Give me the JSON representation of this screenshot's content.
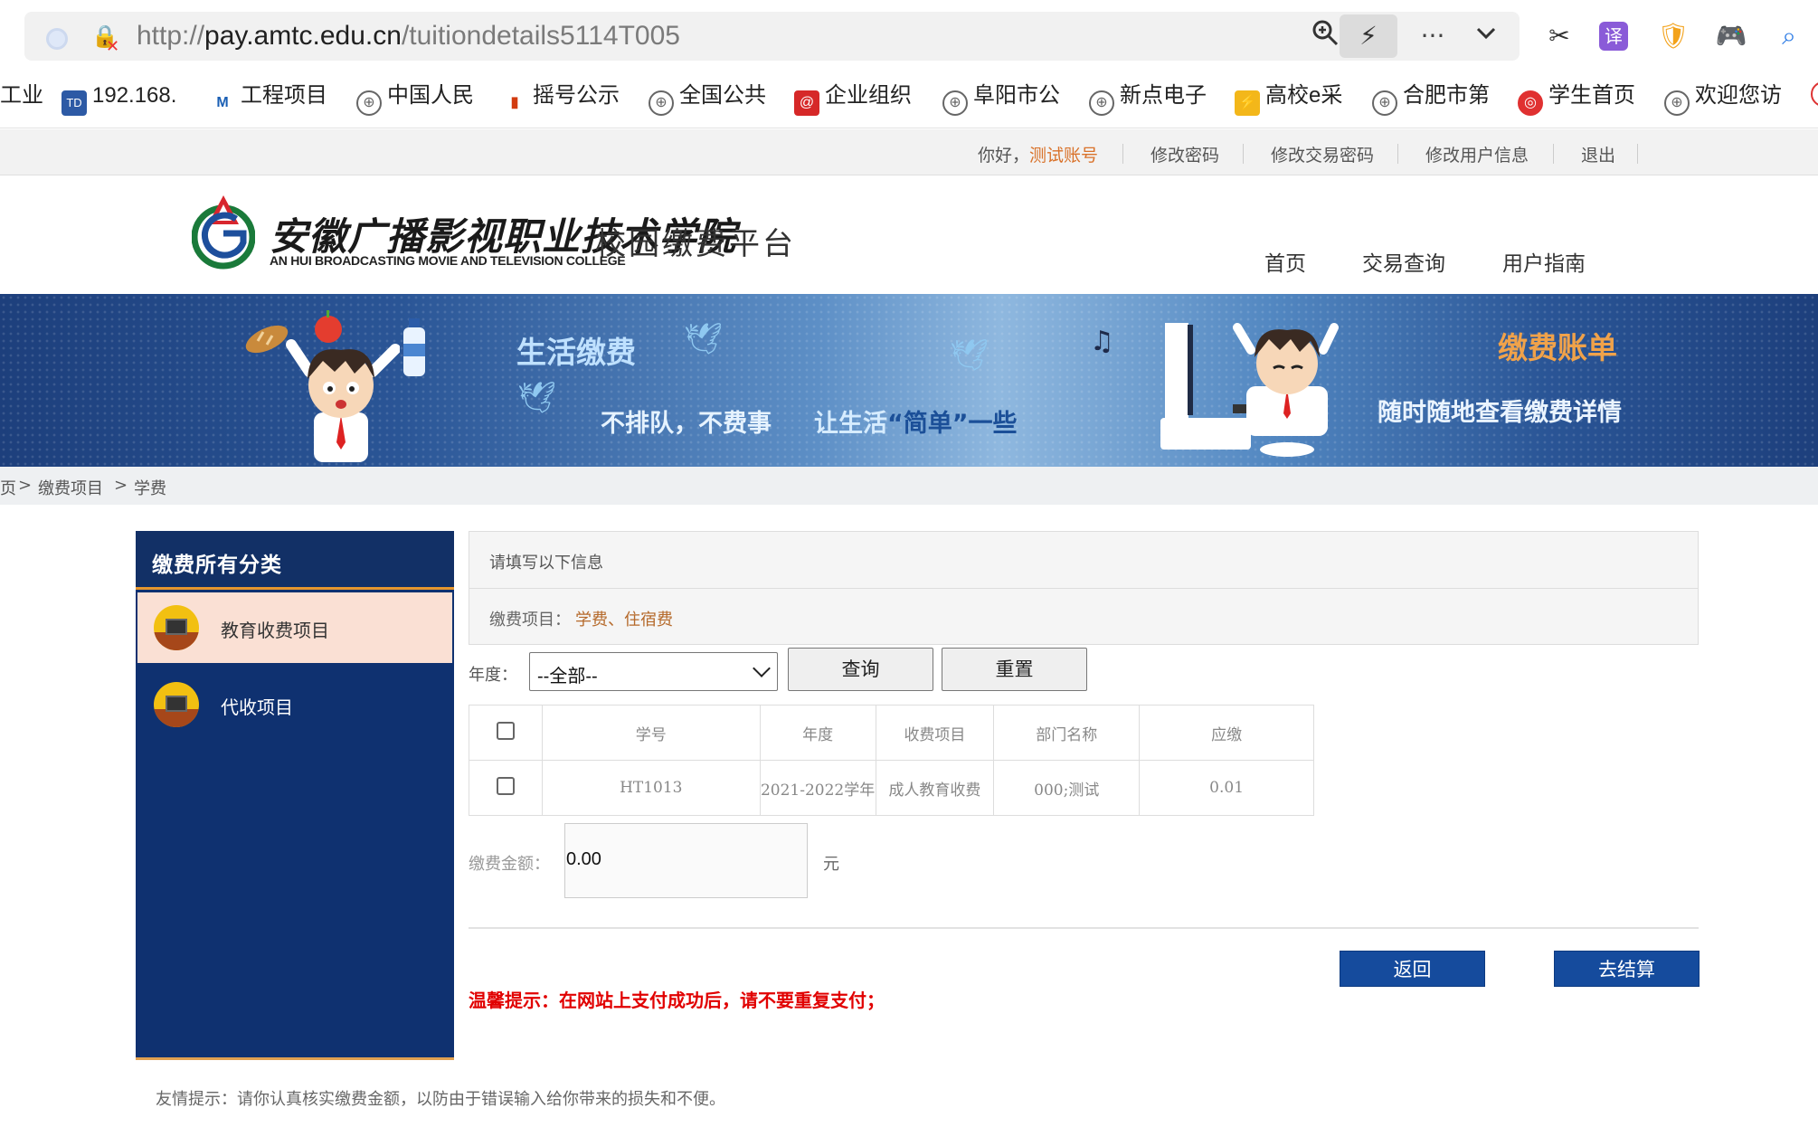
{
  "browser": {
    "url_prefix": "http://",
    "url_domain": "pay.amtc.edu.cn",
    "url_path": "/tuitiondetails5114T005",
    "bookmarks": [
      {
        "label": "工业",
        "icon": "globe-icon"
      },
      {
        "label": "192.168.",
        "icon": "td-icon"
      },
      {
        "label": "工程项目",
        "icon": "m-icon"
      },
      {
        "label": "中国人民",
        "icon": "globe-icon"
      },
      {
        "label": "摇号公示",
        "icon": "chart-icon"
      },
      {
        "label": "全国公共",
        "icon": "globe-icon"
      },
      {
        "label": "企业组织",
        "icon": "at-icon"
      },
      {
        "label": "阜阳市公",
        "icon": "globe-icon"
      },
      {
        "label": "新点电子",
        "icon": "globe-icon"
      },
      {
        "label": "高校e采",
        "icon": "lightning-icon"
      },
      {
        "label": "合肥市第",
        "icon": "globe-icon"
      },
      {
        "label": "学生首页",
        "icon": "weibo-icon"
      },
      {
        "label": "欢迎您访",
        "icon": "globe-icon"
      }
    ]
  },
  "topbar": {
    "greeting": "你好，",
    "account": "测试账号",
    "links": [
      "修改密码",
      "修改交易密码",
      "修改用户信息",
      "退出"
    ]
  },
  "header": {
    "school_cn": "安徽广播影视职业技术学院",
    "school_en": "AN HUI BROADCASTING MOVIE AND TELEVISION COLLEGE",
    "platform": "校园缴费平台",
    "nav": [
      "首页",
      "交易查询",
      "用户指南"
    ]
  },
  "banner": {
    "title_left": "生活缴费",
    "slogan_1": "不排队，不费事",
    "slogan_2_pre": "让生活",
    "slogan_2_key": "“简单”",
    "slogan_2_post": "一些",
    "title_right": "缴费账单",
    "subtitle_right": "随时随地查看缴费详情"
  },
  "breadcrumb": [
    "页",
    ">",
    "缴费项目",
    ">",
    "学费"
  ],
  "sidebar": {
    "title": "缴费所有分类",
    "items": [
      {
        "label": "教育收费项目",
        "active": true
      },
      {
        "label": "代收项目",
        "active": false
      }
    ]
  },
  "info": {
    "heading": "请填写以下信息",
    "item_label": "缴费项目：",
    "item_value": "学费、住宿费"
  },
  "filter": {
    "year_label": "年度：",
    "year_selected": "--全部--",
    "query_button": "查询",
    "reset_button": "重置"
  },
  "table": {
    "headers": [
      "学号",
      "年度",
      "收费项目",
      "部门名称",
      "应缴"
    ],
    "rows": [
      [
        "HT1013",
        "2021-2022学年",
        "成人教育收费",
        "000;测试",
        "0.01"
      ]
    ]
  },
  "amount": {
    "label": "缴费金额：",
    "value": "0.00",
    "unit": "元"
  },
  "actions": {
    "back": "返回",
    "checkout": "去结算"
  },
  "warning": "温馨提示：在网站上支付成功后，请不要重复支付；",
  "tip": "友情提示：请你认真核实缴费金额，以防由于错误输入给你带来的损失和不便。",
  "colors": {
    "sidebar_bg": "#0f3170",
    "primary_button": "#154b9d",
    "warning": "#e10000",
    "accent_orange": "#d9722a"
  }
}
